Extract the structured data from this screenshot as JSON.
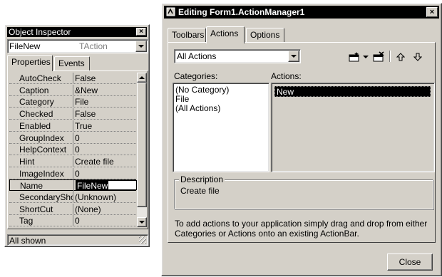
{
  "object_inspector": {
    "title": "Object Inspector",
    "close_glyph": "×",
    "object_name": "FileNew",
    "object_type": "TAction",
    "tabs": [
      {
        "label": "Properties",
        "active": true
      },
      {
        "label": "Events",
        "active": false
      }
    ],
    "properties": [
      {
        "name": "AutoCheck",
        "value": "False"
      },
      {
        "name": "Caption",
        "value": "&New"
      },
      {
        "name": "Category",
        "value": "File"
      },
      {
        "name": "Checked",
        "value": "False"
      },
      {
        "name": "Enabled",
        "value": "True"
      },
      {
        "name": "GroupIndex",
        "value": "0"
      },
      {
        "name": "HelpContext",
        "value": "0"
      },
      {
        "name": "Hint",
        "value": "Create file"
      },
      {
        "name": "ImageIndex",
        "value": "0"
      },
      {
        "name": "Name",
        "value": "FileNew",
        "selected": true
      },
      {
        "name": "SecondaryShortCuts",
        "value": "(Unknown)"
      },
      {
        "name": "ShortCut",
        "value": "(None)"
      },
      {
        "name": "Tag",
        "value": "0"
      }
    ],
    "status": "All shown"
  },
  "dialog": {
    "title": "Editing Form1.ActionManager1",
    "close_glyph": "×",
    "tabs": [
      {
        "label": "Toolbars",
        "active": false
      },
      {
        "label": "Actions",
        "active": true
      },
      {
        "label": "Options",
        "active": false
      }
    ],
    "filter_value": "All Actions",
    "toolbar_icons": [
      "new-action-icon",
      "new-action-dropdown-icon",
      "delete-action-icon",
      "move-up-icon",
      "move-down-icon"
    ],
    "categories_label": "Categories:",
    "actions_label": "Actions:",
    "categories": [
      "(No Category)",
      "File",
      "(All Actions)"
    ],
    "actions": [
      "New"
    ],
    "description_label": "Description",
    "description_text": "Create file",
    "help_text": "To add actions to your application simply drag and drop from either Categories or Actions onto an existing ActionBar.",
    "close_button": "Close"
  },
  "colors": {
    "face": "#d4d0c8",
    "titlebar": "#000000",
    "highlight": "#000000"
  }
}
